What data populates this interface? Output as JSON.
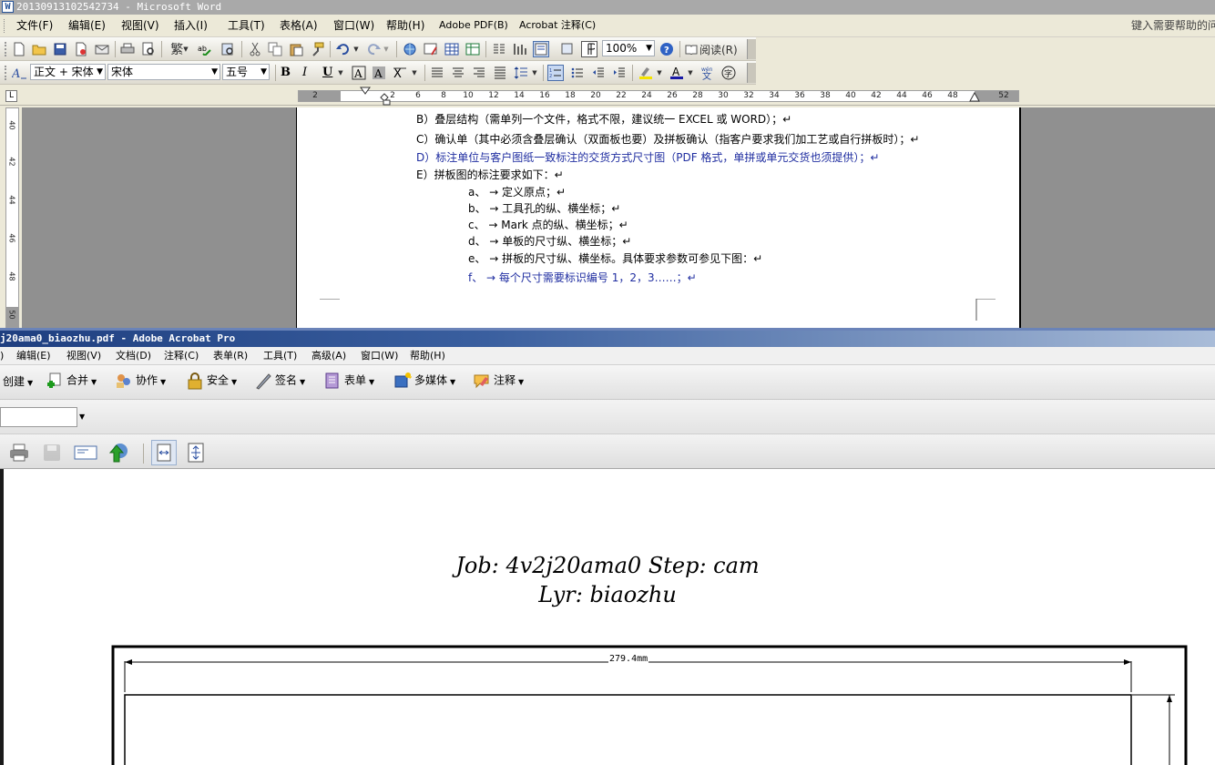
{
  "word": {
    "title": "20130913102542734 - Microsoft Word",
    "menu": [
      "文件(F)",
      "编辑(E)",
      "视图(V)",
      "插入(I)",
      "工具(T)",
      "表格(A)",
      "窗口(W)",
      "帮助(H)",
      "Adobe PDF(B)",
      "Acrobat 注释(C)"
    ],
    "help_placeholder": "键入需要帮助的问题",
    "toolbar": {
      "zoom": "100%",
      "read_label": "阅读(R)",
      "trad_label": "繁"
    },
    "format": {
      "style": "正文 + 宋体",
      "font": "宋体",
      "size": "五号",
      "bold": "B",
      "italic": "I",
      "underline": "U"
    },
    "ruler": {
      "corner": "L",
      "numbers": [
        "2",
        "2",
        "4",
        "6",
        "8",
        "10",
        "12",
        "14",
        "16",
        "18",
        "20",
        "22",
        "24",
        "26",
        "28",
        "30",
        "32",
        "34",
        "36",
        "38",
        "40",
        "42",
        "44",
        "46",
        "48",
        "52"
      ],
      "vnumbers": [
        "40",
        "42",
        "44",
        "46",
        "48",
        "50"
      ]
    },
    "doc_lines": [
      "B）叠层结构（需单列一个文件，格式不限，建议统一 EXCEL 或 WORD）；↵",
      "C）确认单（其中必须含叠层确认（双面板也要）及拼板确认（指客户要求我们加工艺或自行拼板时）；↵",
      "D）标注单位与客户图纸一致标注的交货方式尺寸图（PDF 格式，单拼或单元交货也须提供）；↵",
      "E）拼板图的标注要求如下：↵",
      "a、 → 定义原点；↵",
      "b、 → 工具孔的纵、横坐标；↵",
      "c、 → Mark 点的纵、横坐标；↵",
      "d、 → 单板的尺寸纵、横坐标；↵",
      "e、 → 拼板的尺寸纵、横坐标。具体要求参数可参见下图：↵",
      "f、 → 每个尺寸需要标识编号 1，2，3……；↵"
    ]
  },
  "acrobat": {
    "title": "j20ama0_biaozhu.pdf - Adobe Acrobat Pro",
    "menu": [
      ")",
      "编辑(E)",
      "视图(V)",
      "文档(D)",
      "注释(C)",
      "表单(R)",
      "工具(T)",
      "高级(A)",
      "窗口(W)",
      "帮助(H)"
    ],
    "tasks": [
      "创建",
      "合并",
      "协作",
      "安全",
      "签名",
      "表单",
      "多媒体",
      "注释"
    ],
    "page_input": ""
  },
  "pdf": {
    "line1": "Job: 4v2j20ama0  Step: cam",
    "line2": "Lyr: biaozhu",
    "dimension": "279.4mm"
  },
  "colors": {
    "word_title_bg": "#a9a9a9",
    "acrobat_title_bg": "#1f3f80",
    "doc_blue_text": "#1f2da0",
    "workspace_gray": "#909090"
  }
}
